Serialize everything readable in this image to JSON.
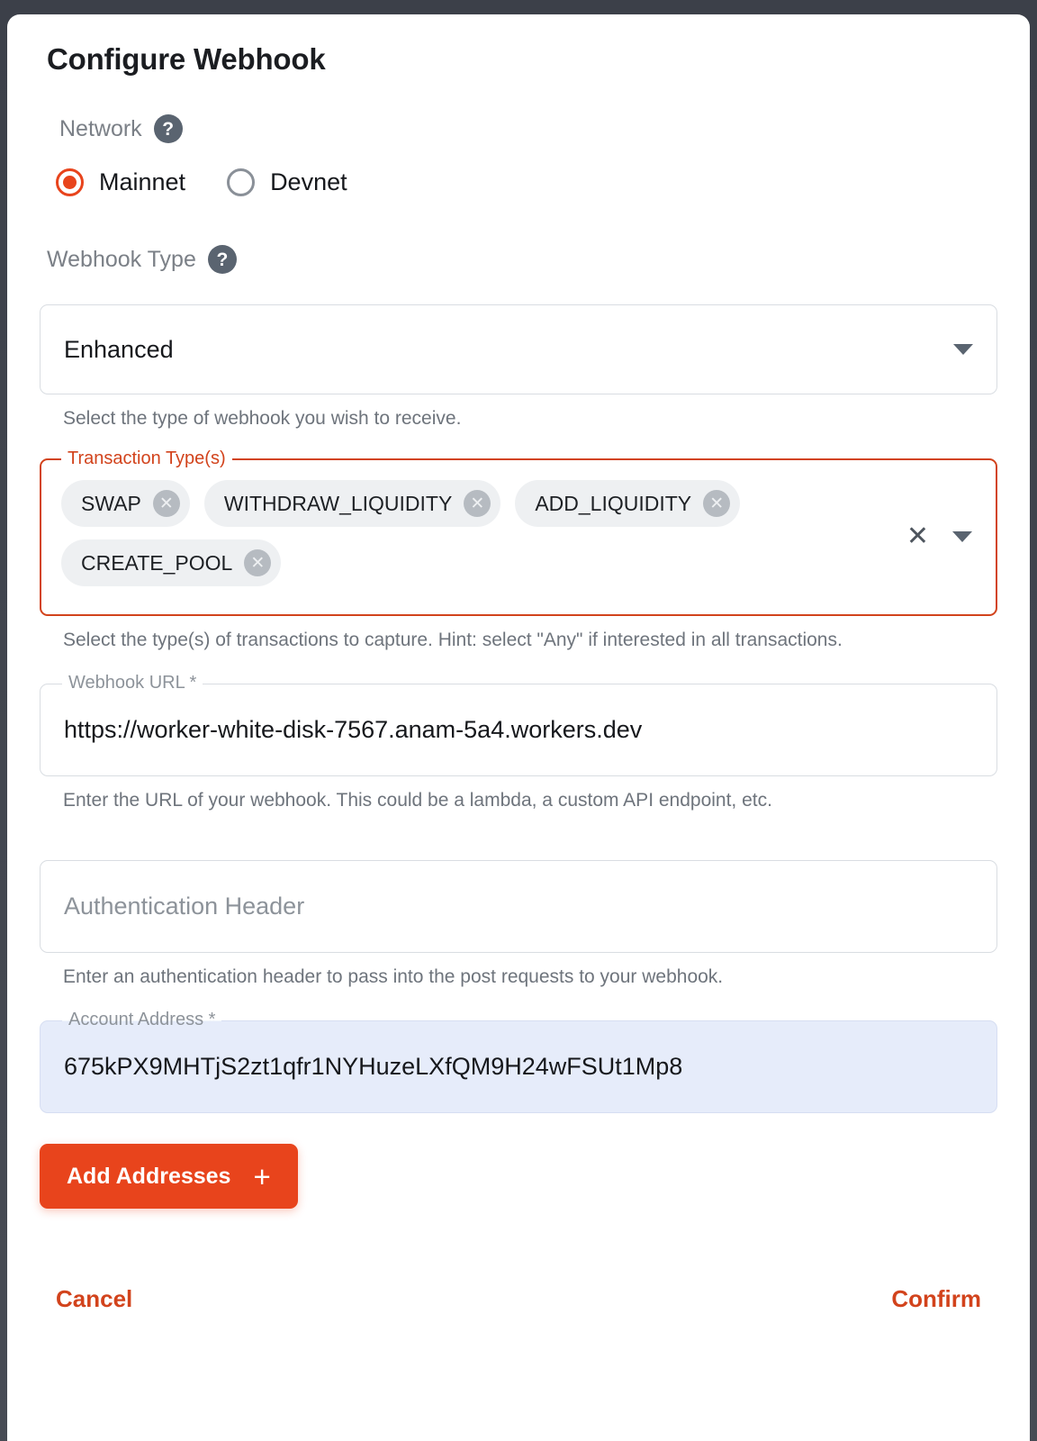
{
  "modal": {
    "title": "Configure Webhook"
  },
  "network": {
    "label": "Network",
    "help_icon": "question-mark-icon",
    "options": [
      {
        "label": "Mainnet",
        "selected": true
      },
      {
        "label": "Devnet",
        "selected": false
      }
    ]
  },
  "webhook_type": {
    "label": "Webhook Type",
    "help_icon": "question-mark-icon",
    "value": "Enhanced",
    "helper": "Select the type of webhook you wish to receive.",
    "caret_icon": "chevron-down-icon"
  },
  "transaction_types": {
    "legend": "Transaction Type(s)",
    "chips": [
      {
        "label": "SWAP",
        "remove_icon": "close-circle-icon"
      },
      {
        "label": "WITHDRAW_LIQUIDITY",
        "remove_icon": "close-circle-icon"
      },
      {
        "label": "ADD_LIQUIDITY",
        "remove_icon": "close-circle-icon"
      },
      {
        "label": "CREATE_POOL",
        "remove_icon": "close-circle-icon"
      }
    ],
    "clear_icon": "close-icon",
    "clear_glyph": "✕",
    "caret_icon": "chevron-down-icon",
    "helper": "Select the type(s) of transactions to capture. Hint: select \"Any\" if interested in all transactions."
  },
  "webhook_url": {
    "legend": "Webhook URL *",
    "value": "https://worker-white-disk-7567.anam-5a4.workers.dev",
    "helper": "Enter the URL of your webhook. This could be a lambda, a custom API endpoint, etc."
  },
  "auth_header": {
    "placeholder": "Authentication Header",
    "value": "",
    "helper": "Enter an authentication header to pass into the post requests to your webhook."
  },
  "account_address": {
    "legend": "Account Address *",
    "value": "675kPX9MHTjS2zt1qfr1NYHuzeLXfQM9H24wFSUt1Mp8"
  },
  "actions": {
    "add_addresses": "Add Addresses",
    "add_icon": "plus-icon",
    "add_glyph": "+",
    "cancel": "Cancel",
    "confirm": "Confirm"
  },
  "colors": {
    "accent": "#e8441c",
    "accent_dark": "#d2431c",
    "label_gray": "#7b8087",
    "help_circle": "#5a6470",
    "chip_bg": "#eef0f2",
    "address_bg": "#e6ecfa"
  }
}
